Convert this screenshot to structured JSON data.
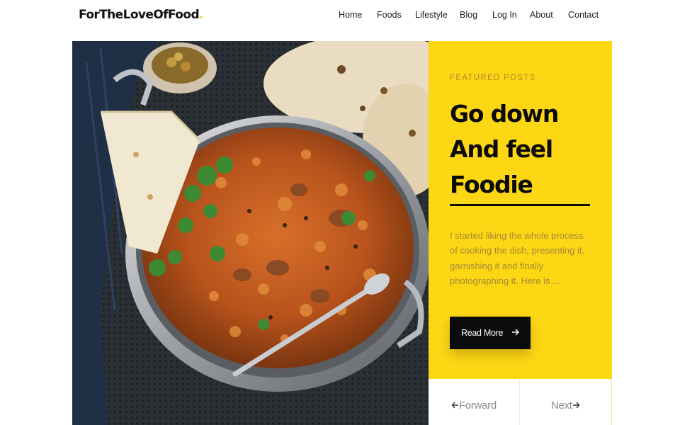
{
  "site": {
    "logo_text": "ForTheLoveOfFood",
    "logo_dot": "."
  },
  "nav": {
    "items": [
      {
        "label": "Home"
      },
      {
        "label": "Foods"
      },
      {
        "label": "Lifestyle"
      },
      {
        "label": "Blog"
      },
      {
        "label": "Log In"
      },
      {
        "label": "About"
      },
      {
        "label": "Contact"
      }
    ]
  },
  "hero": {
    "image_icon": "biryani-dish-photo"
  },
  "featured": {
    "eyebrow": "FEATURED POSTS",
    "headline_line1": "Go down",
    "headline_line2": "And feel",
    "headline_line3": "Foodie",
    "excerpt": "I started liking the whole process of cooking the dish, presenting it, garnishing it and finally photographing it. Here is ...",
    "read_more_label": "Read More",
    "read_more_icon": "arrow-right-icon"
  },
  "pager": {
    "prev_label": "Forward",
    "prev_icon": "arrow-left-icon",
    "next_label": "Next",
    "next_icon": "arrow-right-icon"
  },
  "colors": {
    "accent_yellow": "#fdd614",
    "button_dark": "#0b0b0b",
    "excerpt_text": "#a58a36"
  }
}
